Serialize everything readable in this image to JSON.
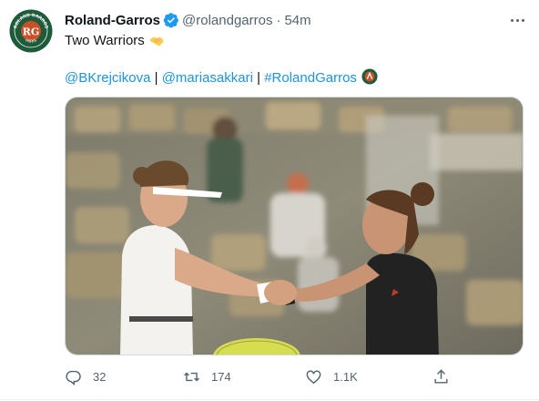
{
  "tweet": {
    "author_name": "Roland-Garros",
    "author_handle": "@rolandgarros",
    "separator": "·",
    "timestamp": "54m",
    "text": "Two Warriors",
    "emoji": "handshake-emoji",
    "mentions": [
      "@BKrejcikova",
      "@mariasakkari"
    ],
    "pipe": "|",
    "hashtag": "#RolandGarros",
    "image_alt_icons": [
      "avatar-logo",
      "roland-garros-hashflag-icon"
    ],
    "stats": {
      "replies": "32",
      "retweets": "174",
      "likes": "1.1K"
    }
  },
  "avatar": {
    "logo_top": "ROLAND GARROS",
    "logo_bottom": "PARIS",
    "monogram": "RG"
  },
  "colors": {
    "link": "#1b95e0",
    "verified": "#1d9bf0",
    "muted": "#536471",
    "clay": "#c8512a",
    "brand_green": "#1d5b3b"
  }
}
